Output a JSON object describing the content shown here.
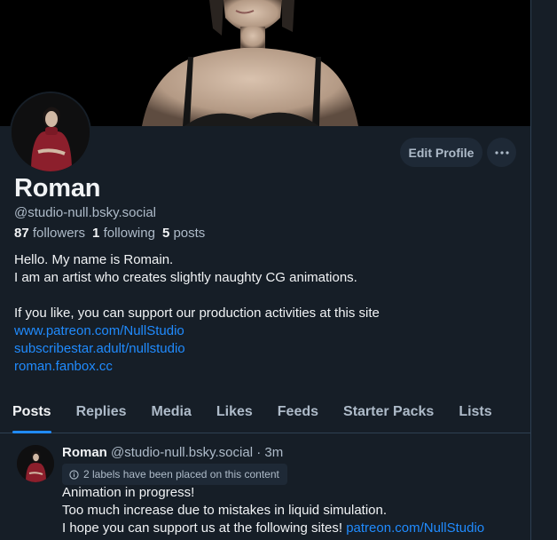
{
  "profile": {
    "display_name": "Roman",
    "handle": "@studio-null.bsky.social",
    "followers_count": "87",
    "followers_label": "followers",
    "following_count": "1",
    "following_label": "following",
    "posts_count": "5",
    "posts_label": "posts",
    "bio_lines": [
      "Hello. My name is Romain.",
      "I am an artist who creates slightly naughty CG animations.",
      "",
      "If you like, you can support our production activities at this site"
    ],
    "links": [
      "www.patreon.com/NullStudio",
      "subscribestar.adult/nullstudio",
      "roman.fanbox.cc"
    ]
  },
  "actions": {
    "edit_profile_label": "Edit Profile",
    "more_icon": "ellipsis-icon"
  },
  "tabs": [
    {
      "label": "Posts",
      "active": true
    },
    {
      "label": "Replies"
    },
    {
      "label": "Media"
    },
    {
      "label": "Likes"
    },
    {
      "label": "Feeds"
    },
    {
      "label": "Starter Packs"
    },
    {
      "label": "Lists"
    }
  ],
  "post": {
    "author_name": "Roman",
    "author_handle": "@studio-null.bsky.social",
    "separator": "·",
    "time": "3m",
    "labels_notice": "2 labels have been placed on this content",
    "text_lines": [
      "Animation in progress!",
      "Too much increase due to mistakes in liquid simulation.",
      "I hope you can support us at the following sites! "
    ],
    "text_link": "patreon.com/NullStudio"
  },
  "colors": {
    "background": "#161e27",
    "accent": "#208bfe",
    "secondary_text": "#aebbc9",
    "button_bg": "#1e2936"
  }
}
